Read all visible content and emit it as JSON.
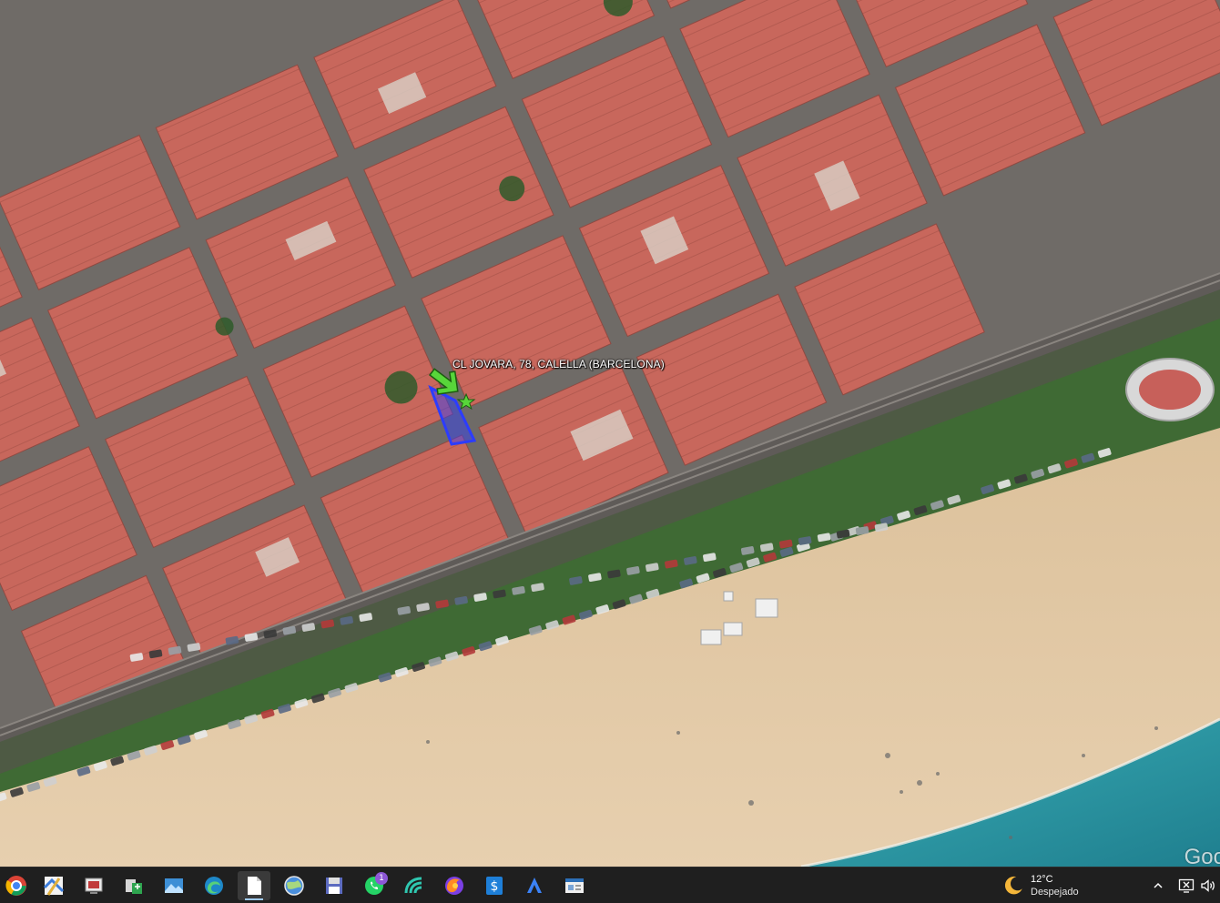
{
  "map": {
    "marker_label": "CL JOVARA, 78, CALELLA (BARCELONA)",
    "watermark": "Goo",
    "colors": {
      "roof": "#c8675c",
      "street": "#6e6a66",
      "beach": "#e3c9a4",
      "sea": "#2a9aa6",
      "trees": "#3f6a34",
      "parcel": "#2c3cff",
      "arrow": "#58d63a"
    }
  },
  "taskbar": {
    "apps": [
      {
        "name": "chrome-icon",
        "label": "Google Chrome"
      },
      {
        "name": "maps-app-icon",
        "label": "Maps"
      },
      {
        "name": "screenshot-tool-icon",
        "label": "Snipping Tool"
      },
      {
        "name": "file-transfer-icon",
        "label": "File transfer"
      },
      {
        "name": "photos-icon",
        "label": "Photos"
      },
      {
        "name": "edge-icon",
        "label": "Microsoft Edge"
      },
      {
        "name": "document-icon",
        "label": "Document"
      },
      {
        "name": "google-earth-icon",
        "label": "Google Earth"
      },
      {
        "name": "save-disk-icon",
        "label": "Save"
      },
      {
        "name": "whatsapp-icon",
        "label": "WhatsApp",
        "badge": "1"
      },
      {
        "name": "wave-app-icon",
        "label": "App"
      },
      {
        "name": "firefox-icon",
        "label": "Firefox"
      },
      {
        "name": "dollar-app-icon",
        "label": "Finance"
      },
      {
        "name": "autocad-icon",
        "label": "AutoCAD"
      },
      {
        "name": "window-app-icon",
        "label": "Window"
      }
    ],
    "weather": {
      "temperature": "12°C",
      "condition": "Despejado",
      "icon": "moon-icon"
    },
    "tray": {
      "chevron": "chevron-up-icon",
      "network": "network-icon",
      "volume": "speaker-icon"
    }
  }
}
